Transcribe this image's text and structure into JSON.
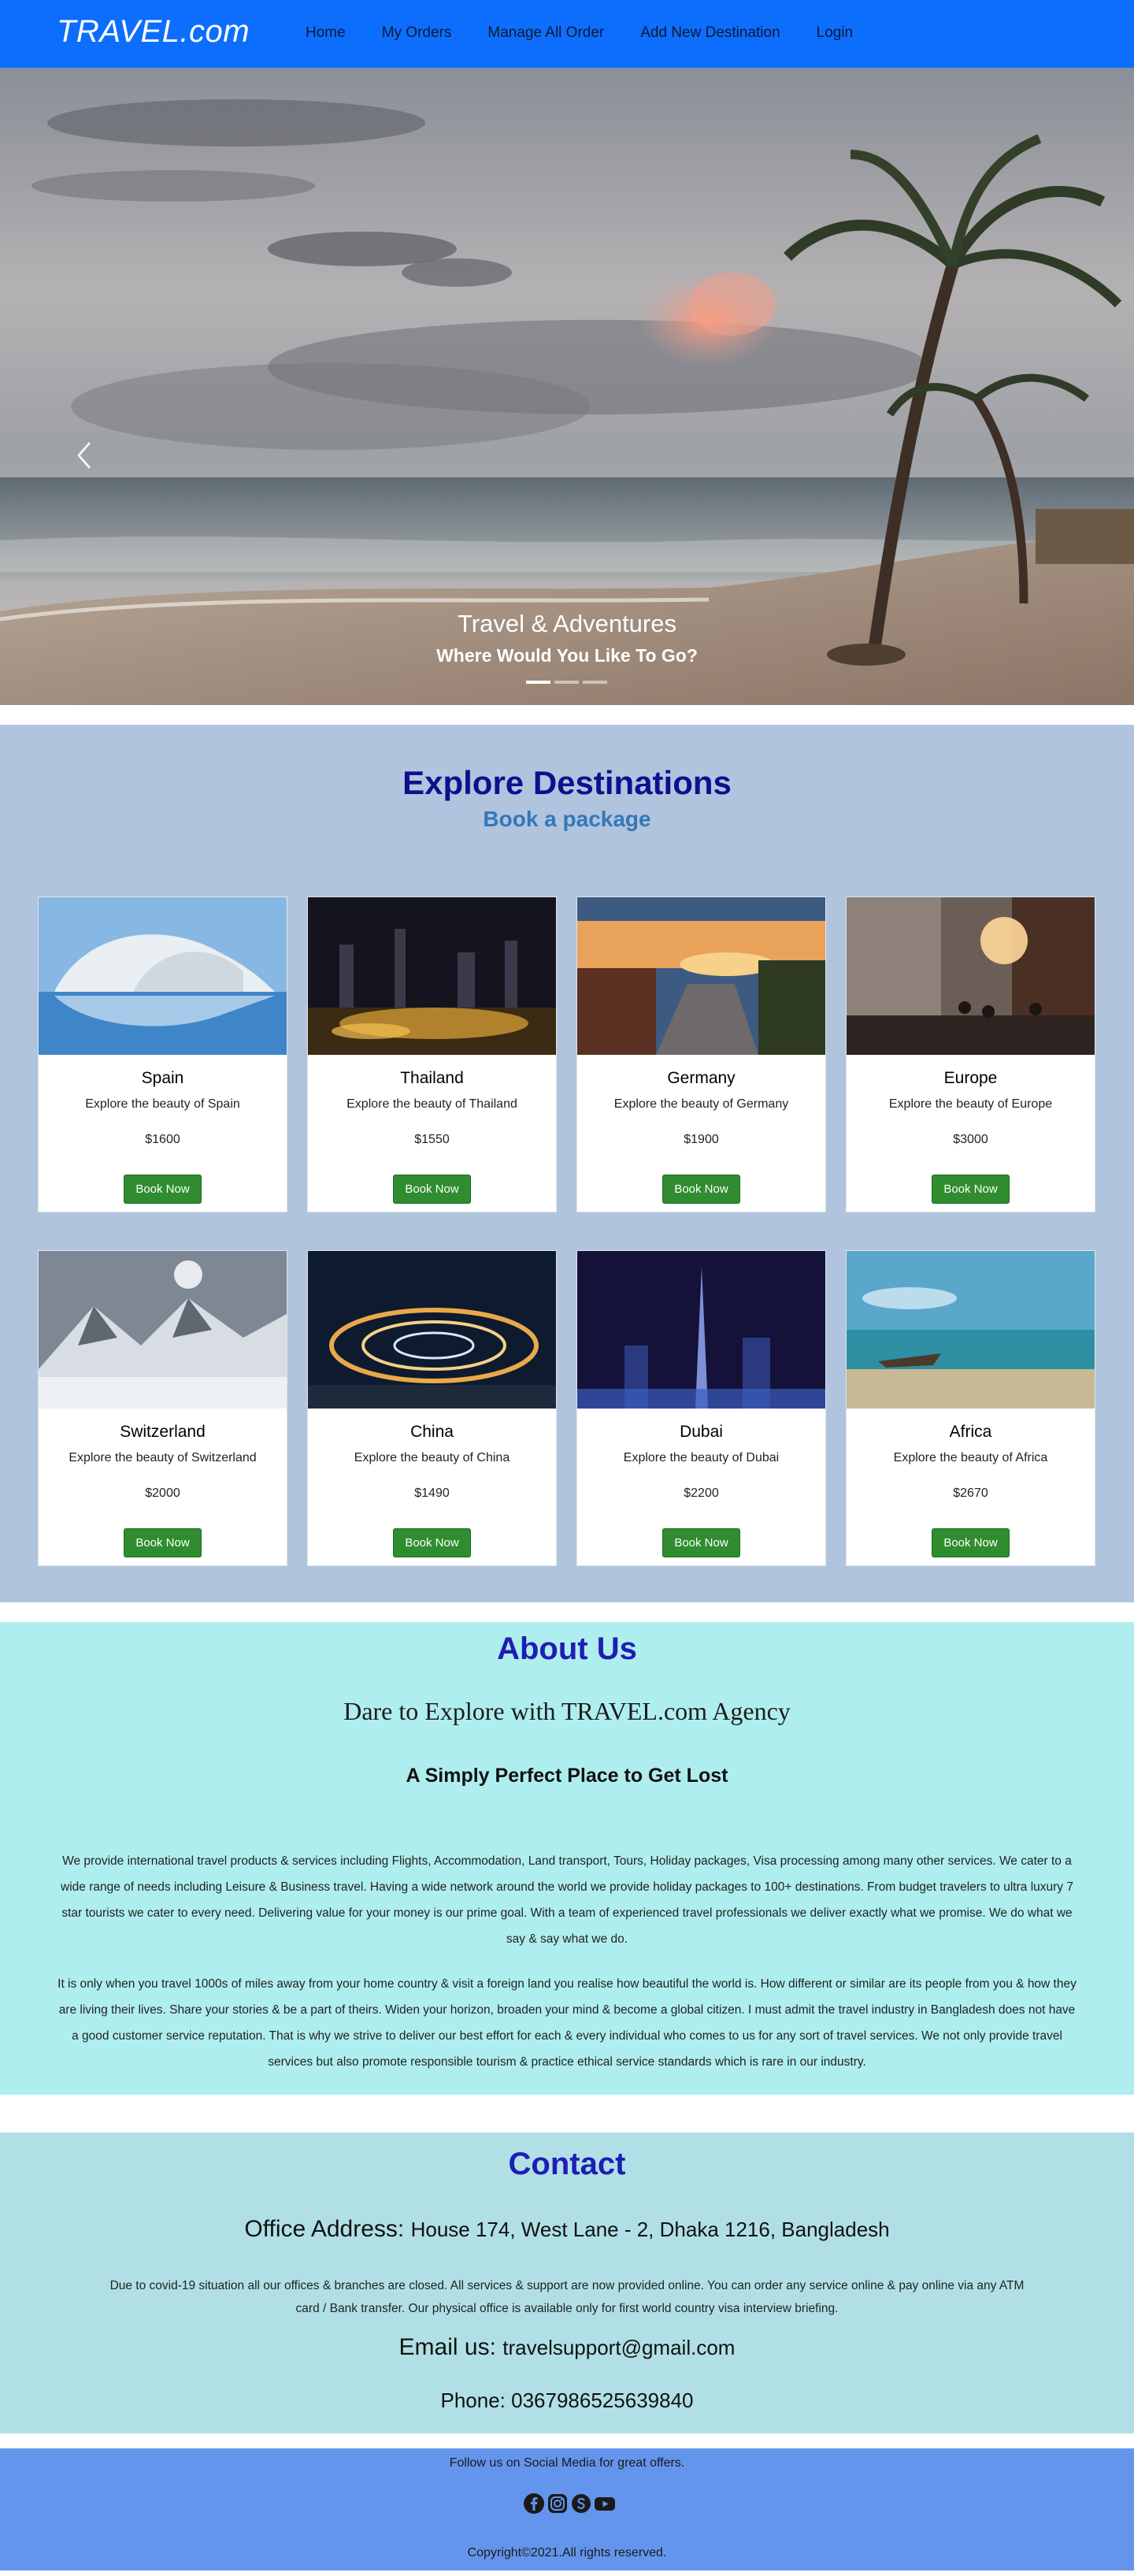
{
  "nav": {
    "brand": "TRAVEL.com",
    "links": [
      "Home",
      "My Orders",
      "Manage All Order",
      "Add New Destination",
      "Login"
    ]
  },
  "hero": {
    "title": "Travel & Adventures",
    "subtitle": "Where Would You Like To Go?",
    "slides": 3,
    "active_slide": 1
  },
  "explore": {
    "title": "Explore Destinations",
    "subtitle": "Book a package",
    "cards": [
      {
        "name": "Spain",
        "desc": "Explore the beauty of Spain",
        "price": "$1600",
        "button": "Book Now"
      },
      {
        "name": "Thailand",
        "desc": "Explore the beauty of Thailand",
        "price": "$1550",
        "button": "Book Now"
      },
      {
        "name": "Germany",
        "desc": "Explore the beauty of Germany",
        "price": "$1900",
        "button": "Book Now"
      },
      {
        "name": "Europe",
        "desc": "Explore the beauty of Europe",
        "price": "$3000",
        "button": "Book Now"
      },
      {
        "name": "Switzerland",
        "desc": "Explore the beauty of Switzerland",
        "price": "$2000",
        "button": "Book Now"
      },
      {
        "name": "China",
        "desc": "Explore the beauty of China",
        "price": "$1490",
        "button": "Book Now"
      },
      {
        "name": "Dubai",
        "desc": "Explore the beauty of Dubai",
        "price": "$2200",
        "button": "Book Now"
      },
      {
        "name": "Africa",
        "desc": "Explore the beauty of Africa",
        "price": "$2670",
        "button": "Book Now"
      }
    ]
  },
  "about": {
    "title": "About Us",
    "tagline": "Dare to Explore with TRAVEL.com Agency",
    "heading": "A Simply Perfect Place to Get Lost",
    "p1": "We provide international travel products & services including Flights, Accommodation, Land transport, Tours, Holiday packages, Visa processing among many other services. We cater to a wide range of needs including Leisure & Business travel. Having a wide network around the world we provide holiday packages to 100+ destinations. From budget travelers to ultra luxury 7 star tourists we cater to every need. Delivering value for your money is our prime goal. With a team of experienced travel professionals we deliver exactly what we promise. We do what we say & say what we do.",
    "p2": "It is only when you travel 1000s of miles away from your home country & visit a foreign land you realise how beautiful the world is. How different or similar are its people from you & how they are living their lives. Share your stories & be a part of theirs. Widen your horizon, broaden your mind & become a global citizen. I must admit the travel industry in Bangladesh does not have a good customer service reputation. That is why we strive to deliver our best effort for each & every individual who comes to us for any sort of travel services. We not only provide travel services but also promote responsible tourism & practice ethical service standards which is rare in our industry."
  },
  "contact": {
    "title": "Contact",
    "address_label": "Office Address:",
    "address": "House 174, West Lane - 2, Dhaka 1216, Bangladesh",
    "note": "Due to covid-19 situation all our offices & branches are closed. All services & support are now provided online. You can order any service online & pay online via any ATM card / Bank transfer. Our physical office is available only for first world country visa interview briefing.",
    "email_label": "Email us:",
    "email": "travelsupport@gmail.com",
    "phone": "Phone: 0367986525639840"
  },
  "footer": {
    "follow": "Follow us on Social Media for great offers.",
    "icons": [
      "facebook-icon",
      "instagram-icon",
      "skype-icon",
      "youtube-icon"
    ],
    "copyright": "Copyright©2021.All rights reserved."
  }
}
